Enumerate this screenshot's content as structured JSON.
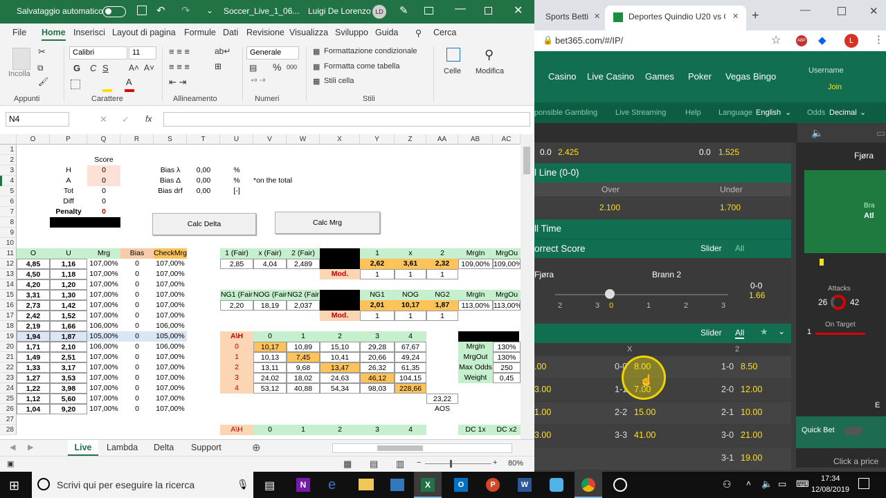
{
  "excel": {
    "autosave": "Salvataggio automatico",
    "filename": "Soccer_Live_1_06...",
    "user": "Luigi De Lorenzo",
    "user_initials": "LD",
    "menu": [
      "File",
      "Home",
      "Inserisci",
      "Layout di pagina",
      "Formule",
      "Dati",
      "Revisione",
      "Visualizza",
      "Sviluppo",
      "Guida",
      "Cerca"
    ],
    "ribbon": {
      "paste": "Incolla",
      "font": "Calibri",
      "size": "11",
      "bold": "G",
      "italic": "C",
      "underline": "S",
      "number_format": "Generale",
      "pct": "%",
      "thousands": "000",
      "cond_format": "Formattazione condizionale",
      "format_table": "Formatta come tabella",
      "cell_styles": "Stili cella",
      "cells": "Celle",
      "modify": "Modifica",
      "groups": [
        "Appunti",
        "Carattere",
        "Allineamento",
        "Numeri",
        "Stili"
      ]
    },
    "namebox": "N4",
    "fx": "fx",
    "columns": [
      "O",
      "P",
      "Q",
      "R",
      "S",
      "T",
      "U",
      "V",
      "W",
      "X",
      "Y",
      "Z",
      "AA",
      "AB",
      "AC"
    ],
    "rows": [
      "1",
      "2",
      "3",
      "4",
      "5",
      "6",
      "7",
      "8",
      "9",
      "10",
      "11",
      "12",
      "13",
      "14",
      "15",
      "16",
      "17",
      "18",
      "19",
      "20",
      "21",
      "22",
      "23",
      "24",
      "25",
      "26",
      "27",
      "28"
    ],
    "score_block": {
      "score": "Score",
      "h": "H",
      "h_val": "0",
      "a": "A",
      "a_val": "0",
      "tot": "Tot",
      "tot_val": "0",
      "diff": "Diff",
      "diff_val": "0",
      "penalty": "Penalty",
      "penalty_val": "0"
    },
    "bias_block": {
      "bias_l": "Bias λ",
      "bias_l_val": "0,00",
      "pct1": "%",
      "bias_d": "Bias Δ",
      "bias_d_val": "0,00",
      "pct2": "%",
      "note": "*on the total",
      "bias_drf": "Bias drf",
      "bias_drf_val": "0,00",
      "unit": "[-]"
    },
    "buttons": {
      "calc_delta": "Calc Delta",
      "calc_mrg": "Calc Mrg"
    },
    "left_table": {
      "headers": [
        "O",
        "U",
        "Mrg",
        "Bias",
        "CheckMrg"
      ],
      "rows": [
        [
          "4,85",
          "1,16",
          "107,00%",
          "0",
          "107,00%"
        ],
        [
          "4,50",
          "1,18",
          "107,00%",
          "0",
          "107,00%"
        ],
        [
          "4,20",
          "1,20",
          "107,00%",
          "0",
          "107,00%"
        ],
        [
          "3,31",
          "1,30",
          "107,00%",
          "0",
          "107,00%"
        ],
        [
          "2,73",
          "1,42",
          "107,00%",
          "0",
          "107,00%"
        ],
        [
          "2,42",
          "1,52",
          "107,00%",
          "0",
          "107,00%"
        ],
        [
          "2,19",
          "1,66",
          "106,00%",
          "0",
          "106,00%"
        ],
        [
          "1,94",
          "1,87",
          "105,00%",
          "0",
          "105,00%"
        ],
        [
          "1,71",
          "2,10",
          "106,00%",
          "0",
          "106,00%"
        ],
        [
          "1,49",
          "2,51",
          "107,00%",
          "0",
          "107,00%"
        ],
        [
          "1,33",
          "3,17",
          "107,00%",
          "0",
          "107,00%"
        ],
        [
          "1,27",
          "3,53",
          "107,00%",
          "0",
          "107,00%"
        ],
        [
          "1,22",
          "3,98",
          "107,00%",
          "0",
          "107,00%"
        ],
        [
          "1,12",
          "5,60",
          "107,00%",
          "0",
          "107,00%"
        ],
        [
          "1,04",
          "9,20",
          "107,00%",
          "0",
          "107,00%"
        ]
      ]
    },
    "fair1": {
      "headers": [
        "1 (Fair)",
        "x (Fair)",
        "2 (Fair)"
      ],
      "vals": [
        "2,85",
        "4,04",
        "2,489"
      ],
      "h2": [
        "1",
        "x",
        "2"
      ],
      "v2": [
        "2,62",
        "3,61",
        "2,32"
      ],
      "mod": "Mod.",
      "mv": [
        "1",
        "1",
        "1"
      ],
      "mrg_h": [
        "MrgIn",
        "MrgOu"
      ],
      "mrg_v": [
        "109,00%",
        "109,00%"
      ]
    },
    "fair2": {
      "headers": [
        "NG1 (Fair",
        "NOG (Fair",
        "NG2 (Fair"
      ],
      "vals": [
        "2,20",
        "18,19",
        "2,037"
      ],
      "h2": [
        "NG1",
        "NOG",
        "NG2"
      ],
      "v2": [
        "2,01",
        "10,17",
        "1,87"
      ],
      "mod": "Mod.",
      "mv": [
        "1",
        "1",
        "1"
      ],
      "mrg_h": [
        "MrgIn",
        "MrgOu"
      ],
      "mrg_v": [
        "113,00%",
        "113,00%"
      ]
    },
    "matrix": {
      "corner": "A\\H",
      "cols": [
        "0",
        "1",
        "2",
        "3",
        "4"
      ],
      "rows": [
        [
          "0",
          "10,17",
          "10,89",
          "15,10",
          "29,28",
          "67,67"
        ],
        [
          "1",
          "10,13",
          "7,45",
          "10,41",
          "20,66",
          "49,24"
        ],
        [
          "2",
          "13,11",
          "9,68",
          "13,47",
          "26,32",
          "61,35"
        ],
        [
          "3",
          "24,02",
          "18,02",
          "24,63",
          "46,12",
          "104,15"
        ],
        [
          "4",
          "53,12",
          "40,88",
          "54,34",
          "98,03",
          "228,66"
        ]
      ],
      "extra": "23,22",
      "aos": "AOS"
    },
    "side": {
      "rows": [
        [
          "MrgIn",
          "130%"
        ],
        [
          "MrgOut",
          "130%"
        ],
        [
          "Max Odds",
          "250"
        ],
        [
          "Weight",
          "0,45"
        ]
      ]
    },
    "row28": {
      "corner": "A\\H",
      "cols": [
        "0",
        "1",
        "2",
        "3",
        "4"
      ],
      "dc1": "DC 1x",
      "dc2": "DC x2"
    },
    "sheet_tabs": [
      "Live",
      "Lambda",
      "Delta",
      "Support"
    ],
    "zoom": "80%"
  },
  "browser": {
    "tab1": "Sports Betti",
    "tab2": "Deportes Quindio U20 vs C",
    "url": "bet365.com/#/IP/",
    "nav": [
      "Casino",
      "Live Casino",
      "Games",
      "Poker",
      "Vegas",
      "Bingo"
    ],
    "username": "Username",
    "join": "Join",
    "sub": {
      "resp": "ponsible Gambling",
      "live": "Live Streaming",
      "help": "Help",
      "lang_l": "Language",
      "lang": "English",
      "odds_l": "Odds",
      "odds": "Decimal"
    },
    "top_row": {
      "l": "0.0",
      "lv": "2.425",
      "r": "0.0",
      "rv": "1.525"
    },
    "line": {
      "title": "l Line (0-0)",
      "over": "Over",
      "under": "Under",
      "ov": "2.100",
      "uv": "1.700"
    },
    "full_time": "ll Time",
    "correct_score": {
      "title": "orrect Score",
      "slider": "Slider",
      "all": "All",
      "team1": "Fjøra",
      "team2": "Brann 2",
      "score": "0-0",
      "odds": "1.66",
      "ticks": [
        "2",
        "3",
        "0",
        "1",
        "2",
        "3"
      ]
    },
    "cs2": {
      "slider": "Slider",
      "all": "All",
      "x": "X",
      "two": "2"
    },
    "grid": [
      [
        ".00",
        "0-0",
        "8.00",
        "1-0",
        "8.50"
      ],
      [
        "3.00",
        "1-1",
        "7.00",
        "2-0",
        "12.00"
      ],
      [
        "1.00",
        "2-2",
        "15.00",
        "2-1",
        "10.00"
      ],
      [
        "3.00",
        "3-3",
        "41.00",
        "3-0",
        "21.00"
      ],
      [
        "",
        "",
        "",
        "3-1",
        "19.00"
      ]
    ],
    "right": {
      "team": "Fjøra",
      "bra": "Bra",
      "atl": "Atl",
      "attacks": "Attacks",
      "a1": "26",
      "a2": "42",
      "on_target": "On Target",
      "ot": "1",
      "quick_bet": "Quick Bet",
      "click": "Click a price",
      "e": "E"
    }
  },
  "taskbar": {
    "search": "Scrivi qui per eseguire la ricerca",
    "time": "17:34",
    "date": "12/08/2019"
  }
}
